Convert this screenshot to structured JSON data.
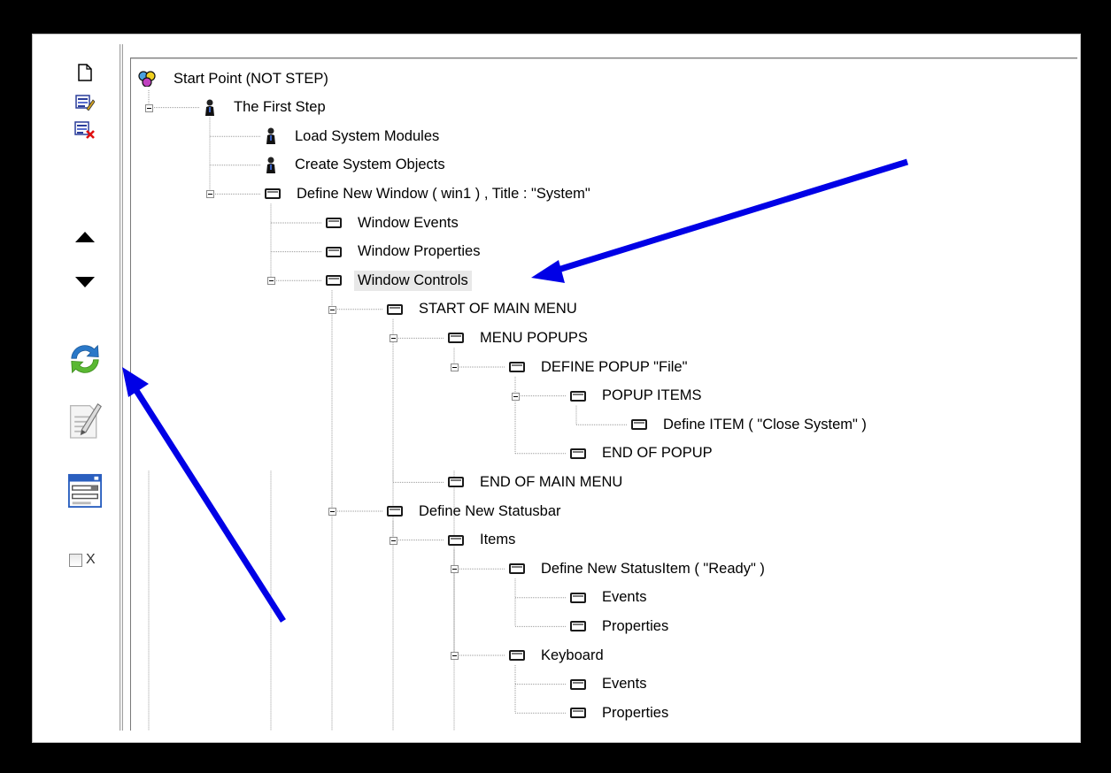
{
  "toolbar": {
    "icons": [
      "new-file-icon",
      "edit-icon",
      "delete-icon",
      "move-up-icon",
      "move-down-icon",
      "refresh-icon",
      "edit-script-icon",
      "window-form-icon"
    ],
    "checkbox_label": "X",
    "checkbox_checked": false
  },
  "tree": {
    "root": "Start Point (NOT STEP)",
    "nodes": [
      "The First Step",
      "Load System Modules",
      "Create System Objects",
      "Define New Window  ( win1 ) , Title : \"System\"",
      "Window Events",
      "Window Properties",
      "Window Controls",
      "START OF MAIN MENU",
      "MENU POPUPS",
      "DEFINE POPUP \"File\"",
      "POPUP ITEMS",
      "Define ITEM ( \"Close System\" )",
      "END OF POPUP",
      "END OF MAIN MENU",
      "Define New Statusbar",
      "Items",
      "Define New StatusItem ( \"Ready\" )",
      "Events",
      "Properties",
      "Keyboard",
      "Events",
      "Properties"
    ],
    "selected": "Window Controls"
  },
  "colors": {
    "annotation_arrow": "#0000e6",
    "background": "#000000",
    "panel": "#ffffff"
  }
}
